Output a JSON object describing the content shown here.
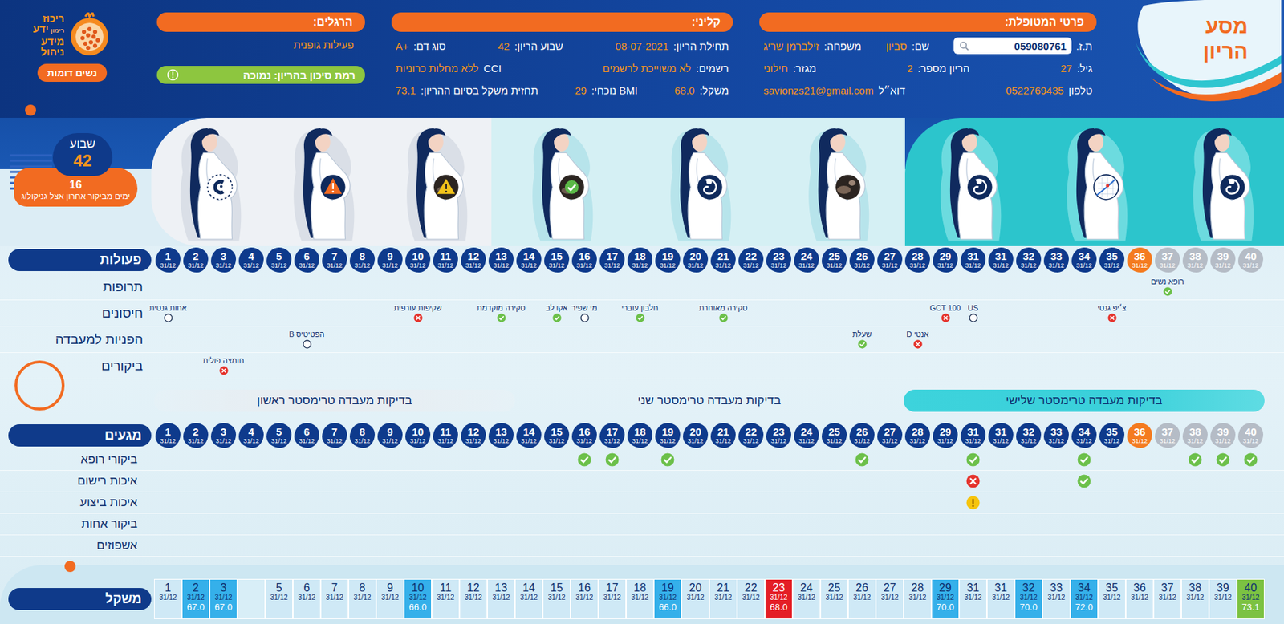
{
  "app_title": [
    "מסע",
    "הריון"
  ],
  "logo": {
    "top": "ריכוז",
    "small": "רימון",
    "mid": "ידע",
    "line3": "מידע",
    "line4": "ניהול"
  },
  "similar_button": "נשים דומות",
  "patient": {
    "title": "פרטי המטופלת:",
    "id_field": {
      "label": "ת.ז.",
      "value": "059080761"
    },
    "rows": [
      [
        {
          "label": "שם:",
          "value": "סביון"
        },
        {
          "label": "משפחה:",
          "value": "זילברמן שריג"
        }
      ],
      [
        {
          "label": "גיל:",
          "value": "27"
        },
        {
          "label": "הריון מספר:",
          "value": "2"
        },
        {
          "label": "מגזר:",
          "value": "חילוני"
        }
      ],
      [
        {
          "label": "טלפון",
          "value": "0522769435"
        },
        {
          "label": "דוא״ל",
          "value": "savionzs21@gmail.com"
        }
      ]
    ]
  },
  "clinical": {
    "title": "קליני:",
    "rows": [
      [
        {
          "label": "תחילת הריון:",
          "value": "08-07-2021"
        },
        {
          "label": "שבוע הריון:",
          "value": "42"
        },
        {
          "label": "סוג דם:",
          "value": "A+"
        }
      ],
      [
        {
          "label": "רשמים:",
          "value": "לא משוייכת לרשמים"
        },
        {
          "label": "CCI",
          "value": "ללא מחלות כרוניות"
        }
      ],
      [
        {
          "label": "משקל:",
          "value": "68.0"
        },
        {
          "label": "BMI נוכחי:",
          "value": "29"
        },
        {
          "label": "תחזית משקל בסיום ההריון:",
          "value": "73.1"
        }
      ]
    ]
  },
  "habits": {
    "title": "הרגלים:",
    "items": [
      "פעילות גופנית"
    ]
  },
  "risk": {
    "label": "רמת סיכון בהריון: נמוכה",
    "level": "low"
  },
  "week_badge": {
    "label": "שבוע",
    "week": "42",
    "days": "16",
    "days_label": "ימים מביקור אחרון אצל גניקולוג"
  },
  "trimesters": [
    {
      "number": 1,
      "figures": [
        {
          "kind": "embryo"
        },
        {
          "kind": "alert"
        },
        {
          "kind": "scan-warning"
        }
      ]
    },
    {
      "number": 2,
      "figures": [
        {
          "kind": "scan-check"
        },
        {
          "kind": "fetus"
        },
        {
          "kind": "scan"
        }
      ]
    },
    {
      "number": 3,
      "figures": [
        {
          "kind": "fetus"
        },
        {
          "kind": "chart"
        },
        {
          "kind": "fetus"
        }
      ]
    }
  ],
  "weeks": [
    {
      "label": "1",
      "date": "31/12",
      "status": "past"
    },
    {
      "label": "2",
      "date": "31/12",
      "status": "past"
    },
    {
      "label": "3",
      "date": "31/12",
      "status": "past"
    },
    {
      "label": "4",
      "date": "31/12",
      "status": "past"
    },
    {
      "label": "5",
      "date": "31/12",
      "status": "past"
    },
    {
      "label": "6",
      "date": "31/12",
      "status": "past"
    },
    {
      "label": "7",
      "date": "31/12",
      "status": "past"
    },
    {
      "label": "8",
      "date": "31/12",
      "status": "past"
    },
    {
      "label": "9",
      "date": "31/12",
      "status": "past"
    },
    {
      "label": "10",
      "date": "31/12",
      "status": "past"
    },
    {
      "label": "11",
      "date": "31/12",
      "status": "past"
    },
    {
      "label": "12",
      "date": "31/12",
      "status": "past"
    },
    {
      "label": "13",
      "date": "31/12",
      "status": "past"
    },
    {
      "label": "14",
      "date": "31/12",
      "status": "past"
    },
    {
      "label": "15",
      "date": "31/12",
      "status": "past"
    },
    {
      "label": "16",
      "date": "31/12",
      "status": "past"
    },
    {
      "label": "17",
      "date": "31/12",
      "status": "past"
    },
    {
      "label": "18",
      "date": "31/12",
      "status": "past"
    },
    {
      "label": "19",
      "date": "31/12",
      "status": "past"
    },
    {
      "label": "20",
      "date": "31/12",
      "status": "past"
    },
    {
      "label": "21",
      "date": "31/12",
      "status": "past"
    },
    {
      "label": "22",
      "date": "31/12",
      "status": "past"
    },
    {
      "label": "23",
      "date": "31/12",
      "status": "past"
    },
    {
      "label": "24",
      "date": "31/12",
      "status": "past"
    },
    {
      "label": "25",
      "date": "31/12",
      "status": "past"
    },
    {
      "label": "26",
      "date": "31/12",
      "status": "past"
    },
    {
      "label": "27",
      "date": "31/12",
      "status": "past"
    },
    {
      "label": "28",
      "date": "31/12",
      "status": "past"
    },
    {
      "label": "29",
      "date": "31/12",
      "status": "past"
    },
    {
      "label": "31",
      "date": "31/12",
      "status": "past"
    },
    {
      "label": "31",
      "date": "31/12",
      "status": "past"
    },
    {
      "label": "32",
      "date": "31/12",
      "status": "past"
    },
    {
      "label": "33",
      "date": "31/12",
      "status": "past"
    },
    {
      "label": "34",
      "date": "31/12",
      "status": "past"
    },
    {
      "label": "35",
      "date": "31/12",
      "status": "past"
    },
    {
      "label": "36",
      "date": "31/12",
      "status": "current"
    },
    {
      "label": "37",
      "date": "31/12",
      "status": "future"
    },
    {
      "label": "38",
      "date": "31/12",
      "status": "future"
    },
    {
      "label": "39",
      "date": "31/12",
      "status": "future"
    },
    {
      "label": "40",
      "date": "31/12",
      "status": "future"
    }
  ],
  "actions": {
    "title": "פעולות",
    "rows": [
      {
        "label": "תרופות",
        "events": [
          {
            "week": "37",
            "label": "רופא נשים",
            "status": "done"
          }
        ]
      },
      {
        "label": "חיסונים",
        "events": [
          {
            "week": "1",
            "label": "אחות גנטית",
            "status": "pending"
          },
          {
            "week": "10",
            "label": "שקיפות עורפית",
            "status": "failed"
          },
          {
            "week": "13",
            "label": "סקירה מוקדמת",
            "status": "done"
          },
          {
            "week": "15",
            "label": "אקו לב",
            "status": "done"
          },
          {
            "week": "16",
            "label": "מי שפיר",
            "status": "pending"
          },
          {
            "week": "18",
            "label": "חלבון עוברי",
            "status": "done"
          },
          {
            "week": "21",
            "label": "סקירה מאוחרת",
            "status": "done"
          },
          {
            "week": "29",
            "label": "GCT 100",
            "status": "failed"
          },
          {
            "week": "31",
            "label": "US",
            "status": "pending"
          },
          {
            "week": "35",
            "label": "צ׳יפ גנטי",
            "status": "failed"
          }
        ]
      },
      {
        "label": "הפניות למעבדה",
        "events": [
          {
            "week": "6",
            "label": "הפטיטיס B",
            "status": "pending"
          },
          {
            "week": "26",
            "label": "שעלת",
            "status": "done"
          },
          {
            "week": "28",
            "label": "אנטי D",
            "status": "failed"
          }
        ]
      },
      {
        "label": "ביקורים",
        "events": [
          {
            "week": "3",
            "label": "חומצה פולית",
            "status": "failed"
          }
        ]
      }
    ]
  },
  "lab_trimesters": [
    {
      "label": "בדיקות מעבדה טרימסטר ראשון",
      "kind": "past"
    },
    {
      "label": "בדיקות מעבדה טרימסטר שני",
      "kind": "plain"
    },
    {
      "label": "בדיקות מעבדה טרימסטר שלישי",
      "kind": "current"
    }
  ],
  "encounters": {
    "title": "מגעים",
    "rows": [
      {
        "label": "ביקורי רופא",
        "events": [
          {
            "week": "16",
            "status": "done"
          },
          {
            "week": "17",
            "status": "done"
          },
          {
            "week": "19",
            "status": "done"
          },
          {
            "week": "26",
            "status": "done"
          },
          {
            "week": "31",
            "status": "done"
          },
          {
            "week": "34",
            "status": "done"
          },
          {
            "week": "38",
            "status": "done"
          },
          {
            "week": "39",
            "status": "done"
          },
          {
            "week": "40",
            "status": "done"
          }
        ]
      },
      {
        "label": "איכות רישום",
        "events": [
          {
            "week": "31",
            "status": "failed"
          },
          {
            "week": "34",
            "status": "done"
          }
        ]
      },
      {
        "label": "איכות ביצוע",
        "events": [
          {
            "week": "31",
            "status": "warning"
          }
        ]
      },
      {
        "label": "ביקור אחות",
        "events": []
      },
      {
        "label": "אשפוזים",
        "events": []
      }
    ]
  },
  "weight": {
    "title": "משקל",
    "cells": [
      {
        "week": "1",
        "date": "31/12",
        "value": "",
        "kind": "plain"
      },
      {
        "week": "2",
        "date": "31/12",
        "value": "67.0",
        "kind": "measured"
      },
      {
        "week": "3",
        "date": "31/12",
        "value": "67.0",
        "kind": "measured"
      },
      {
        "week": "",
        "date": "",
        "value": "",
        "kind": "blank"
      },
      {
        "week": "5",
        "date": "31/12",
        "value": "",
        "kind": "plain"
      },
      {
        "week": "6",
        "date": "31/12",
        "value": "",
        "kind": "plain"
      },
      {
        "week": "7",
        "date": "31/12",
        "value": "",
        "kind": "plain"
      },
      {
        "week": "8",
        "date": "31/12",
        "value": "",
        "kind": "plain"
      },
      {
        "week": "9",
        "date": "31/12",
        "value": "",
        "kind": "plain"
      },
      {
        "week": "10",
        "date": "31/12",
        "value": "66.0",
        "kind": "measured"
      },
      {
        "week": "11",
        "date": "31/12",
        "value": "",
        "kind": "plain"
      },
      {
        "week": "12",
        "date": "31/12",
        "value": "",
        "kind": "plain"
      },
      {
        "week": "13",
        "date": "31/12",
        "value": "",
        "kind": "plain"
      },
      {
        "week": "14",
        "date": "31/12",
        "value": "",
        "kind": "plain"
      },
      {
        "week": "15",
        "date": "31/12",
        "value": "",
        "kind": "plain"
      },
      {
        "week": "16",
        "date": "31/12",
        "value": "",
        "kind": "plain"
      },
      {
        "week": "17",
        "date": "31/12",
        "value": "",
        "kind": "plain"
      },
      {
        "week": "18",
        "date": "31/12",
        "value": "",
        "kind": "plain"
      },
      {
        "week": "19",
        "date": "31/12",
        "value": "66.0",
        "kind": "measured"
      },
      {
        "week": "20",
        "date": "31/12",
        "value": "",
        "kind": "plain"
      },
      {
        "week": "21",
        "date": "31/12",
        "value": "",
        "kind": "plain"
      },
      {
        "week": "22",
        "date": "31/12",
        "value": "",
        "kind": "plain"
      },
      {
        "week": "23",
        "date": "31/12",
        "value": "68.0",
        "kind": "alert"
      },
      {
        "week": "24",
        "date": "31/12",
        "value": "",
        "kind": "plain"
      },
      {
        "week": "25",
        "date": "31/12",
        "value": "",
        "kind": "plain"
      },
      {
        "week": "26",
        "date": "31/12",
        "value": "",
        "kind": "plain"
      },
      {
        "week": "27",
        "date": "31/12",
        "value": "",
        "kind": "plain"
      },
      {
        "week": "28",
        "date": "31/12",
        "value": "",
        "kind": "plain"
      },
      {
        "week": "29",
        "date": "31/12",
        "value": "70.0",
        "kind": "measured"
      },
      {
        "week": "31",
        "date": "31/12",
        "value": "",
        "kind": "plain"
      },
      {
        "week": "31",
        "date": "31/12",
        "value": "",
        "kind": "plain"
      },
      {
        "week": "32",
        "date": "31/12",
        "value": "70.0",
        "kind": "measured"
      },
      {
        "week": "33",
        "date": "31/12",
        "value": "",
        "kind": "plain"
      },
      {
        "week": "34",
        "date": "31/12",
        "value": "72.0",
        "kind": "measured"
      },
      {
        "week": "35",
        "date": "31/12",
        "value": "",
        "kind": "plain"
      },
      {
        "week": "36",
        "date": "31/12",
        "value": "",
        "kind": "plain"
      },
      {
        "week": "37",
        "date": "31/12",
        "value": "",
        "kind": "plain"
      },
      {
        "week": "38",
        "date": "31/12",
        "value": "",
        "kind": "plain"
      },
      {
        "week": "39",
        "date": "31/12",
        "value": "",
        "kind": "plain"
      },
      {
        "week": "40",
        "date": "31/12",
        "value": "73.1",
        "kind": "final"
      }
    ]
  }
}
